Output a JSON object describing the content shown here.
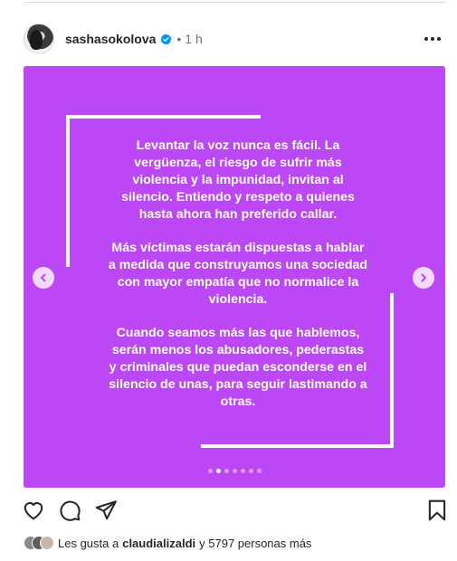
{
  "post": {
    "username": "sashasokolova",
    "separator": "•",
    "time": "1 h"
  },
  "media": {
    "background_color": "#bb48f4",
    "paragraphs": [
      "Levantar la voz nunca es fácil. La vergüenza, el riesgo de sufrir más violencia y la impunidad, invitan al silencio. Entiendo y respeto a quienes hasta ahora han preferido callar.",
      "Más víctimas estarán dispuestas a hablar a medida que construyamos una sociedad con mayor empatía que no normalice la violencia.",
      "Cuando seamos más las que hablemos, serán menos los abusadores, pederastas y criminales que puedan esconderse en el silencio de unas, para seguir lastimando a otras."
    ],
    "carousel": {
      "total": 7,
      "active": 2
    }
  },
  "icons": {
    "verified": "verified-badge-icon",
    "more": "more-horizontal-icon",
    "prev": "chevron-left-icon",
    "next": "chevron-right-icon",
    "like": "heart-icon",
    "comment": "comment-icon",
    "share": "paper-plane-icon",
    "save": "bookmark-icon"
  },
  "likes": {
    "prefix": "Les gusta a",
    "user": "claudializaldi",
    "suffix": "y 5797 personas más"
  },
  "colors": {
    "verified_blue": "#0095f6",
    "text": "#262626",
    "muted": "#737373"
  }
}
